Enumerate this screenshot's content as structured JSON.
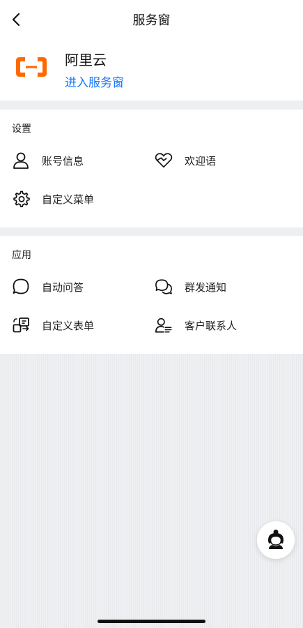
{
  "header": {
    "title": "服务窗"
  },
  "profile": {
    "name": "阿里云",
    "link_label": "进入服务窗",
    "brand_color": "#ff6a00"
  },
  "settings": {
    "title": "设置",
    "items": [
      {
        "label": "账号信息",
        "icon": "user-icon"
      },
      {
        "label": "欢迎语",
        "icon": "heart-handshake-icon"
      },
      {
        "label": "自定义菜单",
        "icon": "gear-icon"
      }
    ]
  },
  "apps": {
    "title": "应用",
    "items": [
      {
        "label": "自动问答",
        "icon": "chat-bubble-icon"
      },
      {
        "label": "群发通知",
        "icon": "chat-bubbles-icon"
      },
      {
        "label": "自定义表单",
        "icon": "form-icon"
      },
      {
        "label": "客户联系人",
        "icon": "contact-list-icon"
      }
    ]
  },
  "colors": {
    "link": "#1677ff",
    "background": "#eeeff1"
  }
}
